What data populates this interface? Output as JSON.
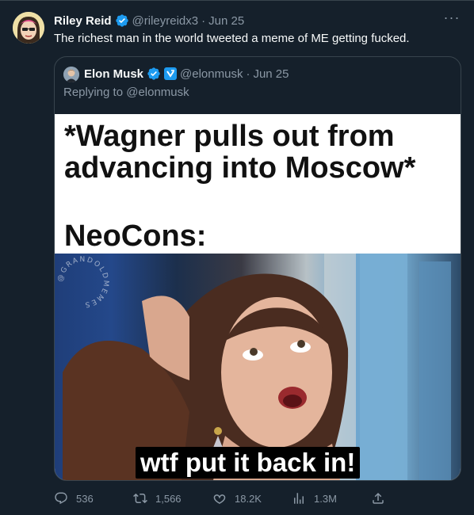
{
  "tweet": {
    "author_name": "Riley Reid",
    "handle": "@rileyreidx3",
    "separator": "·",
    "date": "Jun 25",
    "text": "The richest man in the world tweeted a meme of ME getting fucked.",
    "more_label": "···"
  },
  "quote": {
    "author_name": "Elon Musk",
    "handle": "@elonmusk",
    "separator": "·",
    "date": "Jun 25",
    "replying_to": "Replying to @elonmusk",
    "meme": {
      "caption_line1": "*Wagner pulls out from",
      "caption_line2": "advancing into Moscow*",
      "caption_neocons": "NeoCons:",
      "watermark": "@GRANDOLDMEMES",
      "subtitle": "wtf put it back in!"
    }
  },
  "actions": {
    "replies": "536",
    "retweets": "1,566",
    "likes": "18.2K",
    "views": "1.3M"
  },
  "colors": {
    "background": "#15202b",
    "text": "#f7f9f9",
    "muted": "#8b98a5",
    "border": "#38444d",
    "verified_blue": "#1d9bf0"
  }
}
